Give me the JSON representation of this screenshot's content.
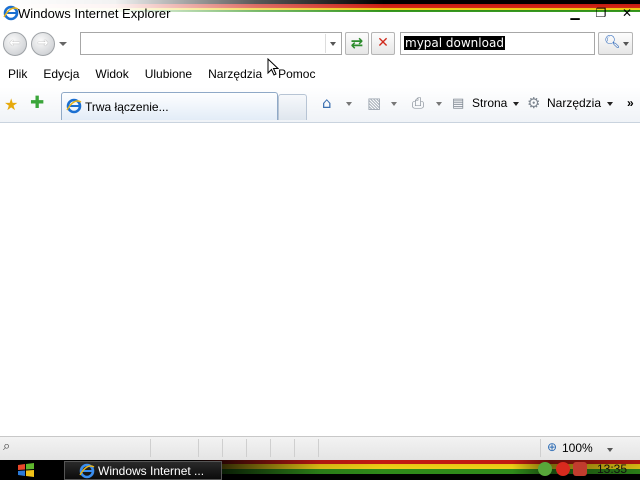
{
  "window": {
    "title": "Windows Internet Explorer",
    "minimize_icon": "minimize-icon",
    "restore_icon": "restore-icon",
    "close_icon": "close-icon"
  },
  "address_bar": {
    "value": "",
    "back_icon": "back-arrow-icon",
    "forward_icon": "forward-arrow-icon",
    "refresh_icon": "refresh-icon",
    "stop_icon": "stop-icon"
  },
  "search": {
    "value": "mypal download",
    "search_icon": "magnifier-icon"
  },
  "menu": {
    "items": [
      "Plik",
      "Edycja",
      "Widok",
      "Ulubione",
      "Narzędzia",
      "Pomoc"
    ]
  },
  "tabs": {
    "active_label": "Trwa łączenie..."
  },
  "commands": {
    "page_label": "Strona",
    "tools_label": "Narzędzia",
    "more": "»"
  },
  "statusbar": {
    "zoom": "100%"
  },
  "taskbar": {
    "task_label": "Windows Internet ...",
    "clock": "13:35"
  },
  "colors": {
    "rasta_red": "#c21a12",
    "rasta_yellow": "#f0d21b",
    "rasta_green": "#2f8a1a",
    "selection_bg": "#000000"
  }
}
